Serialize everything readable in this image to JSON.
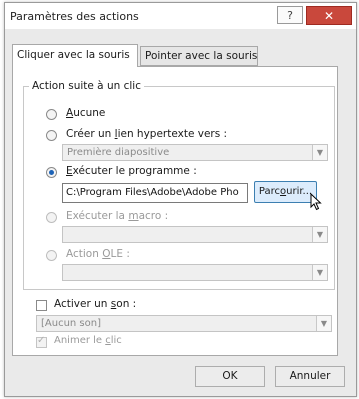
{
  "dialog": {
    "title": "Paramètres des actions",
    "help_label": "?",
    "close_label": "✕"
  },
  "tabs": [
    {
      "label": "Cliquer avec la souris",
      "active": true
    },
    {
      "label": "Pointer avec la souris",
      "active": false
    }
  ],
  "group": {
    "legend": "Action suite à un clic"
  },
  "options": {
    "none": {
      "label_pre": "",
      "accel": "A",
      "label_post": "ucune"
    },
    "hyperlink": {
      "label_pre": "Créer un ",
      "accel": "l",
      "label_post": "ien hypertexte vers :"
    },
    "hyperlink_value": "Première diapositive",
    "run_program": {
      "label_pre": "",
      "accel": "E",
      "label_post": "xécuter le programme :"
    },
    "program_path": "C:\\Program Files\\Adobe\\Adobe Pho",
    "browse": {
      "label_pre": "Parc",
      "accel": "o",
      "label_post": "urir..."
    },
    "run_macro": {
      "label_pre": "Exécuter la ",
      "accel": "m",
      "label_post": "acro :"
    },
    "ole_action": {
      "label_pre": "Action ",
      "accel": "O",
      "label_post": "LE :"
    }
  },
  "sound": {
    "checkbox": {
      "label_pre": "Activer un ",
      "accel": "s",
      "label_post": "on :"
    },
    "value": "[Aucun son]"
  },
  "animate": {
    "label_pre": "Animer le ",
    "accel": "c",
    "label_post": "lic"
  },
  "buttons": {
    "ok": "OK",
    "cancel": "Annuler"
  },
  "colors": {
    "selected_radio": "#1d63b7",
    "close_button": "#c9483c",
    "focused_button": "#dcecfc"
  }
}
